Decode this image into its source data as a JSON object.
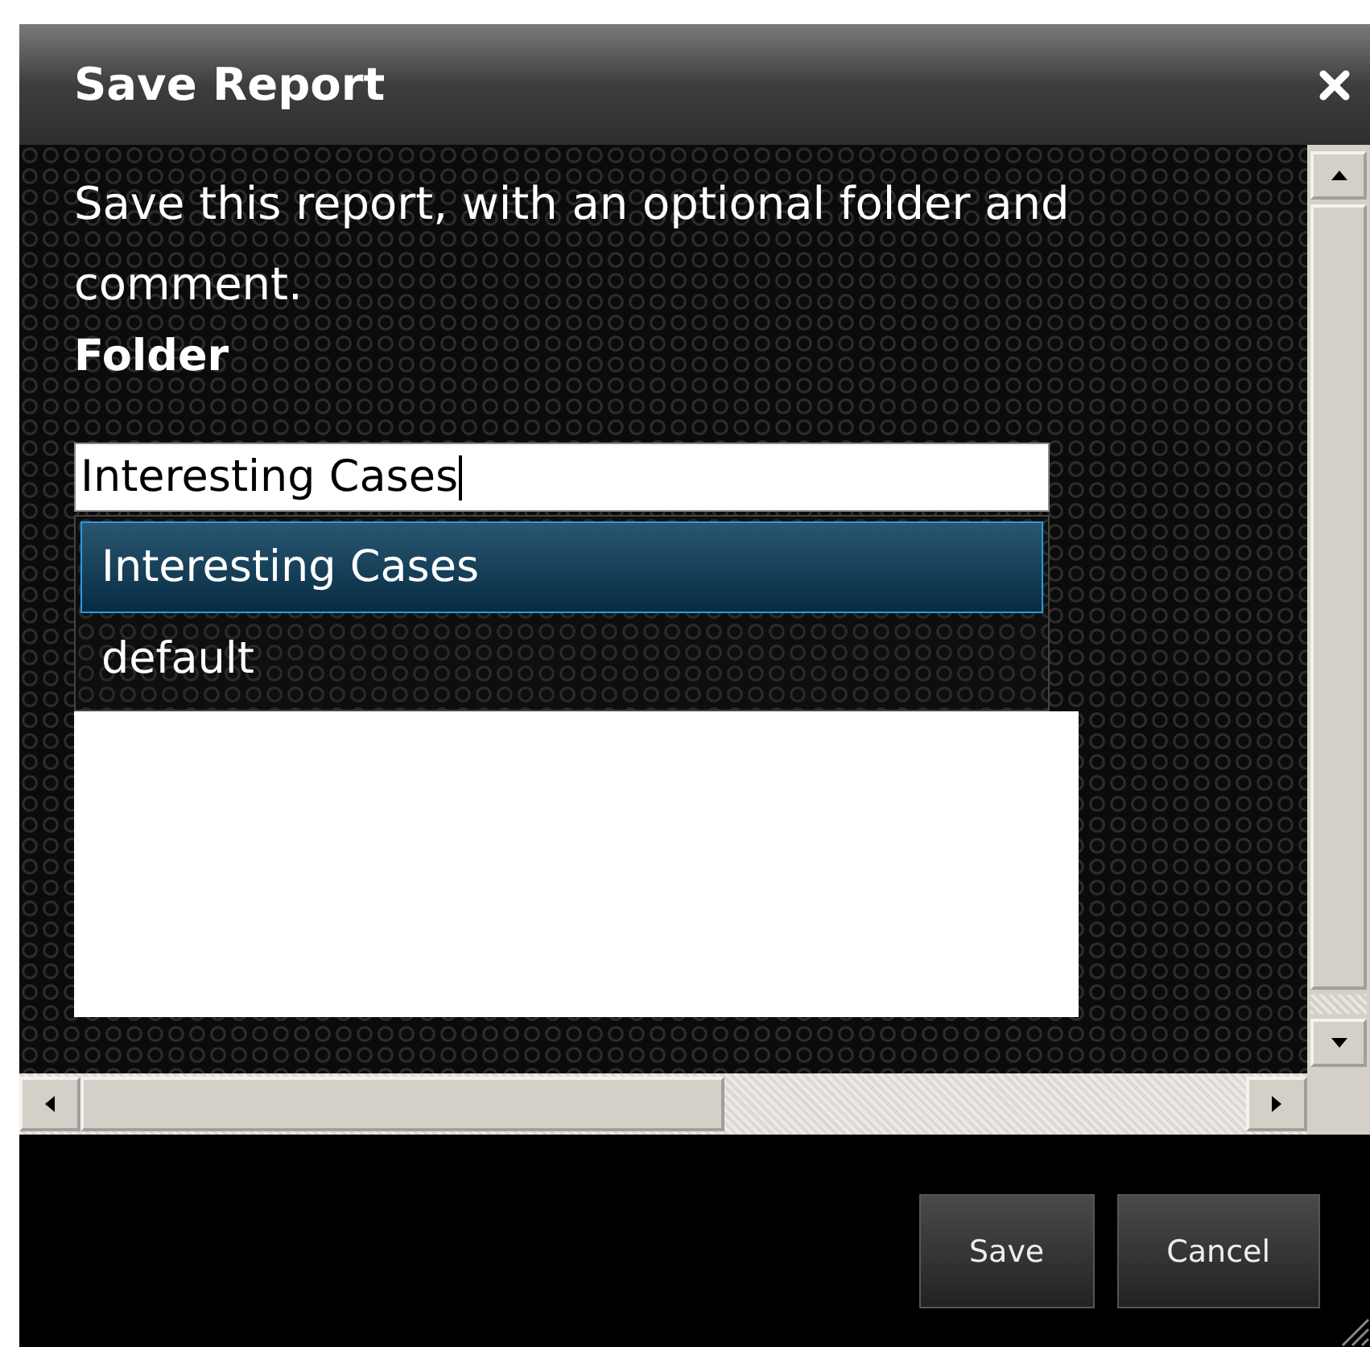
{
  "window": {
    "title": "Save Report"
  },
  "description": "Save this report, with an optional folder and comment.",
  "folder": {
    "label": "Folder",
    "value": "Interesting Cases"
  },
  "suggestions": [
    {
      "label": "Interesting Cases",
      "selected": true
    },
    {
      "label": "default",
      "selected": false
    }
  ],
  "buttons": [
    "Save",
    "Cancel"
  ]
}
